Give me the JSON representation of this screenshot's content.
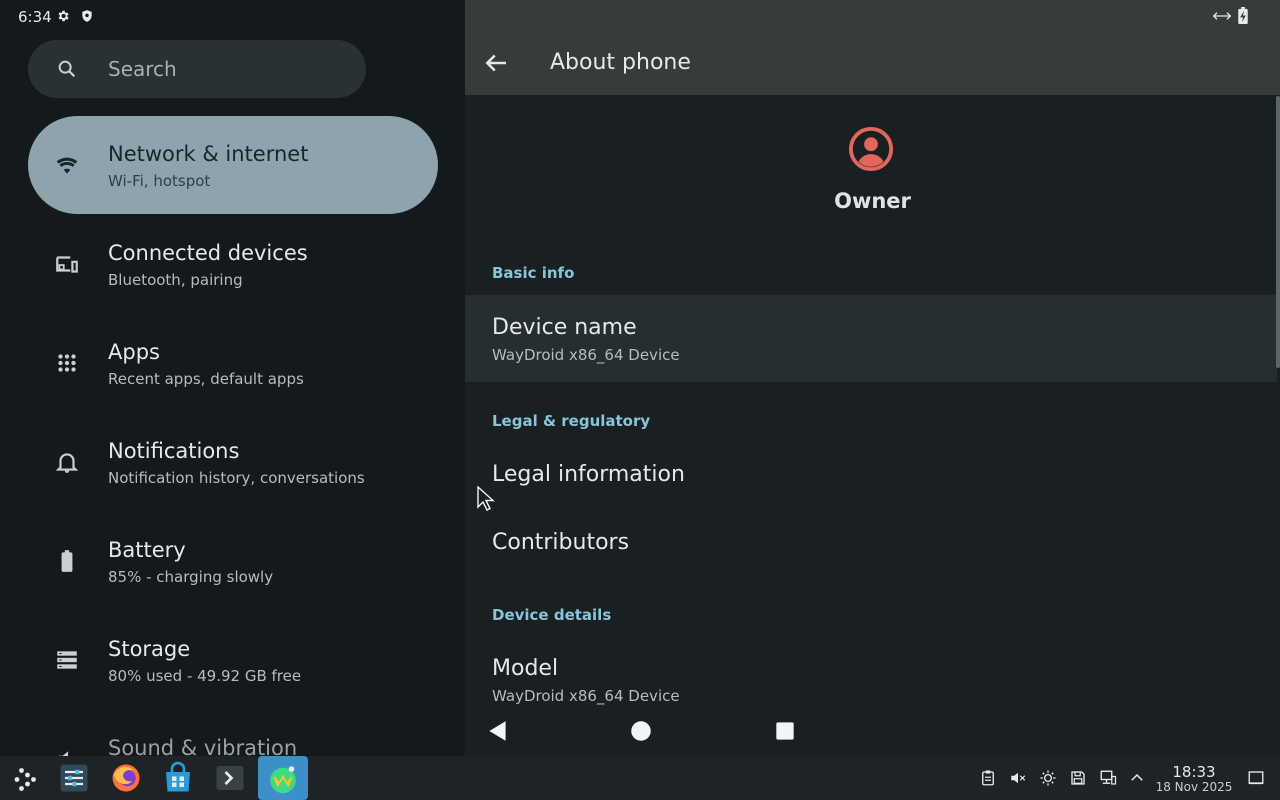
{
  "status_bar": {
    "time": "6:34"
  },
  "search": {
    "placeholder": "Search"
  },
  "settings_menu": [
    {
      "title": "Network & internet",
      "subtitle": "Wi-Fi, hotspot",
      "icon": "wifi-icon",
      "active": true
    },
    {
      "title": "Connected devices",
      "subtitle": "Bluetooth, pairing",
      "icon": "devices-icon"
    },
    {
      "title": "Apps",
      "subtitle": "Recent apps, default apps",
      "icon": "apps-grid-icon"
    },
    {
      "title": "Notifications",
      "subtitle": "Notification history, conversations",
      "icon": "bell-icon"
    },
    {
      "title": "Battery",
      "subtitle": "85% - charging slowly",
      "icon": "battery-icon"
    },
    {
      "title": "Storage",
      "subtitle": "80% used - 49.92 GB free",
      "icon": "storage-icon"
    },
    {
      "title": "Sound & vibration",
      "subtitle": "",
      "icon": "sound-icon"
    }
  ],
  "about": {
    "title": "About phone",
    "owner_name": "Owner",
    "sections": {
      "basic_info": "Basic info",
      "legal": "Legal & regulatory",
      "device_details": "Device details"
    },
    "device_name": {
      "title": "Device name",
      "value": "WayDroid x86_64 Device"
    },
    "legal_information": "Legal information",
    "contributors": "Contributors",
    "model": {
      "title": "Model",
      "value": "WayDroid x86_64 Device"
    }
  },
  "taskbar": {
    "clock_time": "18:33",
    "clock_date": "18 Nov 2025",
    "apps": [
      "app-launcher-icon",
      "system-settings-icon",
      "firefox-icon",
      "store-icon",
      "terminal-icon",
      "waydroid-icon"
    ]
  },
  "colors": {
    "active_item_bg": "#8ea3ab",
    "section_header": "#86c6d8",
    "avatar": "#e1675c",
    "taskbar_active": "#3c8fc7"
  }
}
